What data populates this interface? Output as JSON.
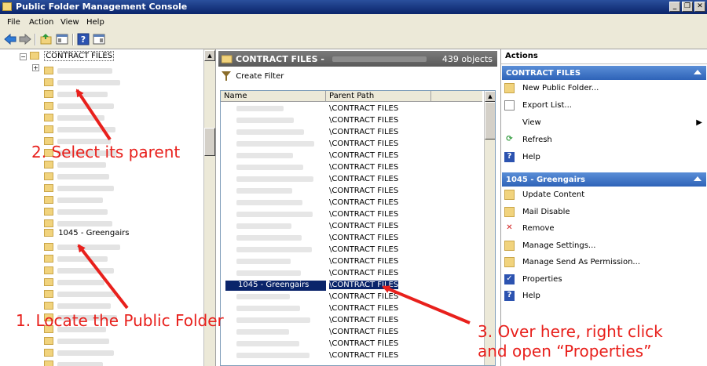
{
  "window": {
    "title": "Public Folder Management Console"
  },
  "menu": [
    "File",
    "Action",
    "View",
    "Help"
  ],
  "tree": {
    "root_label": "CONTRACT FILES",
    "located_label": "1045 - Greengairs"
  },
  "results": {
    "header_title": "CONTRACT FILES -",
    "count_text": "439 objects",
    "create_filter": "Create Filter",
    "columns": [
      "Name",
      "Parent Path"
    ],
    "selected_name": "1045 - Greengairs",
    "parent_path": "\\CONTRACT FILES"
  },
  "actions": {
    "header": "Actions",
    "section1_title": "CONTRACT FILES",
    "section1_items": [
      {
        "label": "New Public Folder...",
        "icon": "new-folder-icon"
      },
      {
        "label": "Export List...",
        "icon": "export-icon"
      },
      {
        "label": "View",
        "icon": "none"
      },
      {
        "label": "Refresh",
        "icon": "refresh-icon"
      },
      {
        "label": "Help",
        "icon": "help-icon"
      }
    ],
    "section2_title": "1045 - Greengairs",
    "section2_items": [
      {
        "label": "Update Content",
        "icon": "update-content-icon"
      },
      {
        "label": "Mail Disable",
        "icon": "mail-disable-icon"
      },
      {
        "label": "Remove",
        "icon": "remove-icon"
      },
      {
        "label": "Manage Settings...",
        "icon": "settings-icon"
      },
      {
        "label": "Manage Send As Permission...",
        "icon": "permission-icon"
      },
      {
        "label": "Properties",
        "icon": "properties-icon"
      },
      {
        "label": "Help",
        "icon": "help-icon"
      }
    ]
  },
  "annotations": {
    "step1": "1. Locate the Public Folder",
    "step2": "2. Select its parent",
    "step3_line1": "3. Over here, right click",
    "step3_line2": "and open “Properties”"
  },
  "colors": {
    "annotation": "#e8201c",
    "section_header": "#2e63b8",
    "selection": "#0a246a"
  }
}
